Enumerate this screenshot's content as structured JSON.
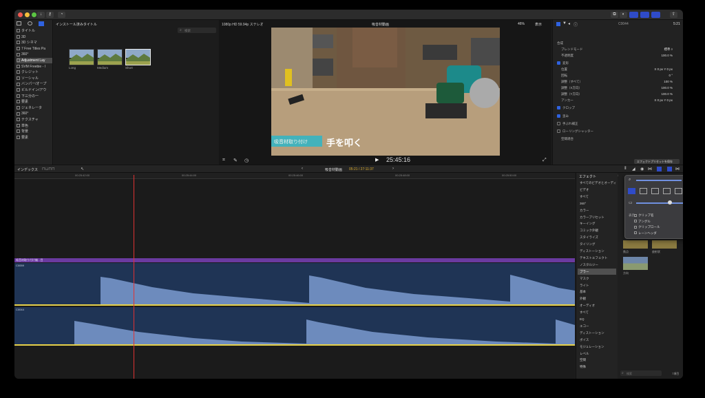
{
  "browser": {
    "section_label": "インストール済みタイトル",
    "search_placeholder": "検索",
    "sidebar_items": [
      {
        "label": "タイトル"
      },
      {
        "label": "3D"
      },
      {
        "label": "3D シネマ"
      },
      {
        "label": "7 Free Titles Pa"
      },
      {
        "label": "360°"
      },
      {
        "label": "Adjustment Lay"
      },
      {
        "label": "SVM Freebie - I"
      },
      {
        "label": "クレジット"
      },
      {
        "label": "ソーシャル"
      },
      {
        "label": "バンパー/オープ"
      },
      {
        "label": "ビルドイン/アウ"
      },
      {
        "label": "下三分の一"
      },
      {
        "label": "要素"
      },
      {
        "label": "ジェネレータ"
      },
      {
        "label": "360°"
      },
      {
        "label": "テクスチャ"
      },
      {
        "label": "単色"
      },
      {
        "label": "背景"
      },
      {
        "label": "要素"
      }
    ],
    "thumbs": [
      {
        "label": "Long"
      },
      {
        "label": "Medium"
      },
      {
        "label": "Short"
      }
    ]
  },
  "viewer": {
    "format": "1080p HD 59.94p ステレオ",
    "title": "吸音材動画",
    "zoom": "46%",
    "view_label": "表示",
    "caption_left": "吸音材取り付け",
    "caption_main": "手を叩く",
    "timecode": "25:45:16"
  },
  "inspector": {
    "clip_name": "C0044",
    "duration": "5:21",
    "rows": [
      {
        "label": "合成",
        "value": ""
      },
      {
        "label": "ブレンドモード",
        "value": "標準 ◊"
      },
      {
        "label": "不透明度",
        "value": "100.0 %"
      },
      {
        "label": "変形",
        "value": ""
      },
      {
        "label": "位置",
        "value": "X 0 px  Y 0 px"
      },
      {
        "label": "回転",
        "value": "0 °"
      },
      {
        "label": "調整（すべて）",
        "value": "100 %"
      },
      {
        "label": "調整（X方向）",
        "value": "100.0 %"
      },
      {
        "label": "調整（Y方向）",
        "value": "100.0 %"
      },
      {
        "label": "アンカー",
        "value": "X 0 px  Y 0 px"
      },
      {
        "label": "クロップ",
        "value": ""
      },
      {
        "label": "歪み",
        "value": ""
      },
      {
        "label": "手ぶれ補正",
        "value": ""
      },
      {
        "label": "ローリングシャッター",
        "value": ""
      },
      {
        "label": "空間適合",
        "value": ""
      }
    ],
    "save_preset": "エフェクトプリセットを保存"
  },
  "timeline": {
    "index_label": "インデックス",
    "project_name": "吸音材動画",
    "project_time": "05:21 / 27:11:37",
    "ruler_ticks": [
      "00:25:42:00",
      "00:25:44:00",
      "00:25:46:00",
      "00:25:48:00",
      "00:25:50:00",
      "00:25:52:00"
    ],
    "title_clip": "吸音材取り付け編 - 目",
    "clip_a": "C0059",
    "clip_b": "C0044"
  },
  "effects": {
    "header": "エフェクト",
    "items": [
      "すべてのビデオとオーディ",
      "ビデオ",
      "すべて",
      "360°",
      "カラー",
      "カラープリセット",
      "キーイング",
      "コミック外観",
      "スタイライズ",
      "タイリング",
      "ディストーション",
      "テキストエフェクト",
      "ノスタルジー",
      "ブラー",
      "マスク",
      "ライト",
      "基本",
      "外観",
      "オーディオ",
      "すべて",
      "EQ",
      "エコー",
      "ディストーション",
      "ボイス",
      "モジュレーション",
      "レベル",
      "空間",
      "特殊"
    ],
    "selected": "ブラー",
    "search_placeholder": "検索",
    "count": "7項目",
    "grid_labels": [
      "焦点",
      "放射状",
      "方向"
    ]
  },
  "popover": {
    "display_label": "表示:",
    "options": [
      "クリップ名",
      "アングル",
      "クリップロール",
      "レーンヘッダ"
    ]
  },
  "colors": {
    "accent": "#2f4bc8",
    "audio_bg": "#1f3455",
    "waveform": "#6d8bbd",
    "title_clip": "#6a3aa0",
    "playhead": "#e03232"
  }
}
